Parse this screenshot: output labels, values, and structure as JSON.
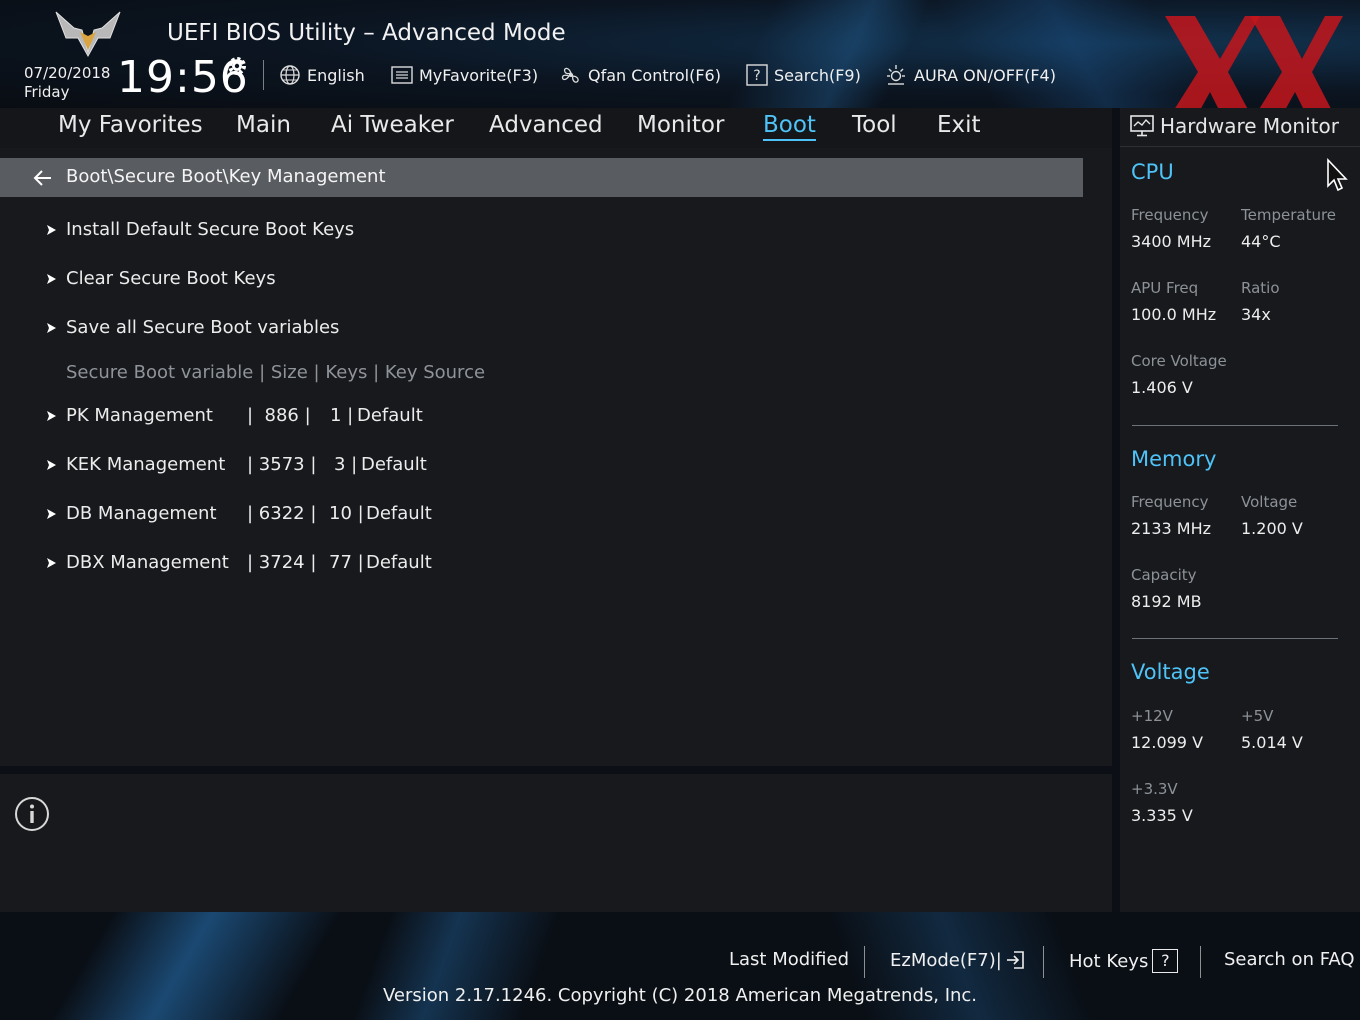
{
  "header": {
    "title": "UEFI BIOS Utility – Advanced Mode",
    "date": "07/20/2018",
    "day": "Friday",
    "time": "19:56",
    "toolbar": {
      "language": "English",
      "favorite": "MyFavorite(F3)",
      "qfan": "Qfan Control(F6)",
      "search": "Search(F9)",
      "aura": "AURA ON/OFF(F4)"
    }
  },
  "nav": {
    "items": [
      "My Favorites",
      "Main",
      "Ai Tweaker",
      "Advanced",
      "Monitor",
      "Boot",
      "Tool",
      "Exit"
    ],
    "active": "Boot"
  },
  "breadcrumb": "Boot\\Secure Boot\\Key Management",
  "menu": {
    "actions": [
      "Install Default Secure Boot Keys",
      "Clear Secure Boot Keys",
      "Save all Secure Boot variables"
    ],
    "table_header": "Secure Boot variable  |  Size |  Keys |  Key Source",
    "rows": [
      {
        "name": "PK Management",
        "size": "|  886 |",
        "keys": "1 |",
        "source": "Default"
      },
      {
        "name": "KEK Management",
        "size": "| 3573 |",
        "keys": "3 |",
        "source": "Default"
      },
      {
        "name": "DB Management",
        "size": "| 6322 |",
        "keys": "10 |",
        "source": "Default"
      },
      {
        "name": "DBX Management",
        "size": "| 3724 |",
        "keys": "77 |",
        "source": "Default"
      }
    ]
  },
  "hardware_monitor": {
    "title": "Hardware Monitor",
    "cpu": {
      "heading": "CPU",
      "frequency_label": "Frequency",
      "frequency": "3400 MHz",
      "temperature_label": "Temperature",
      "temperature": "44°C",
      "apu_label": "APU Freq",
      "apu": "100.0 MHz",
      "ratio_label": "Ratio",
      "ratio": "34x",
      "core_voltage_label": "Core Voltage",
      "core_voltage": "1.406 V"
    },
    "memory": {
      "heading": "Memory",
      "frequency_label": "Frequency",
      "frequency": "2133 MHz",
      "voltage_label": "Voltage",
      "voltage": "1.200 V",
      "capacity_label": "Capacity",
      "capacity": "8192 MB"
    },
    "voltage": {
      "heading": "Voltage",
      "v12_label": "+12V",
      "v12": "12.099 V",
      "v5_label": "+5V",
      "v5": "5.014 V",
      "v33_label": "+3.3V",
      "v33": "3.335 V"
    }
  },
  "footer": {
    "last_modified": "Last Modified",
    "ezmode": "EzMode(F7)|",
    "hotkeys": "Hot Keys",
    "hotkeys_key": "?",
    "faq": "Search on FAQ",
    "version": "Version 2.17.1246. Copyright (C) 2018 American Megatrends, Inc."
  },
  "colors": {
    "accent": "#4fc3f7",
    "breadcrumb_bg": "#595c60",
    "panel_bg": "#17191c"
  }
}
